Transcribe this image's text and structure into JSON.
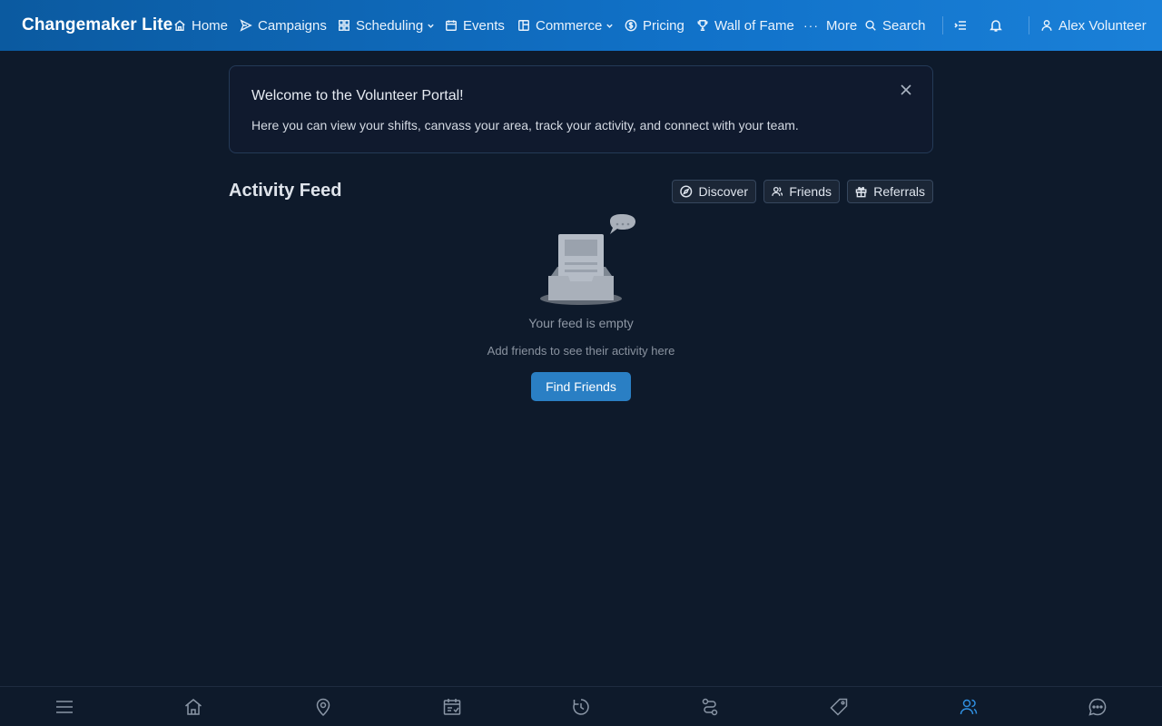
{
  "app": {
    "brand": "Changemaker Lite"
  },
  "nav": {
    "items": [
      {
        "label": "Home",
        "icon": "home-icon"
      },
      {
        "label": "Campaigns",
        "icon": "send-icon"
      },
      {
        "label": "Scheduling",
        "icon": "grid-icon",
        "has_dropdown": true
      },
      {
        "label": "Events",
        "icon": "calendar-icon"
      },
      {
        "label": "Commerce",
        "icon": "storefront-icon",
        "has_dropdown": true
      },
      {
        "label": "Pricing",
        "icon": "dollar-circle-icon"
      },
      {
        "label": "Wall of Fame",
        "icon": "trophy-icon"
      },
      {
        "label": "More",
        "icon": "ellipsis-icon"
      },
      {
        "label": "Search",
        "icon": "search-icon"
      }
    ],
    "user": "Alex Volunteer"
  },
  "welcome": {
    "title": "Welcome to the Volunteer Portal!",
    "text": "Here you can view your shifts, canvass your area, track your activity, and connect with your team."
  },
  "feed": {
    "title": "Activity Feed",
    "actions": [
      {
        "label": "Discover",
        "icon": "compass-icon"
      },
      {
        "label": "Friends",
        "icon": "users-icon"
      },
      {
        "label": "Referrals",
        "icon": "gift-icon"
      }
    ],
    "empty_title": "Your feed is empty",
    "empty_sub": "Add friends to see their activity here",
    "cta": "Find Friends"
  },
  "bottom_nav": {
    "items": [
      "menu-icon",
      "home-icon",
      "map-pin-icon",
      "calendar-check-icon",
      "history-icon",
      "route-icon",
      "tag-icon",
      "users-icon",
      "chat-icon"
    ],
    "active": "users-icon"
  },
  "colors": {
    "nav_gradient_start": "#0b5aa0",
    "nav_gradient_end": "#1a80d8",
    "background": "#0e1a2b",
    "accent": "#2a7fc4",
    "active_icon": "#2f8fe0"
  }
}
